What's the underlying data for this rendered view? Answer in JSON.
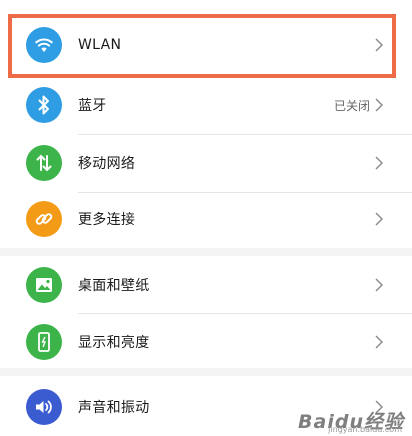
{
  "settings": {
    "items": [
      {
        "label": "WLAN",
        "value": "",
        "icon": "wifi-icon",
        "icon_color": "#2f9de4",
        "highlighted": true
      },
      {
        "label": "蓝牙",
        "value": "已关闭",
        "icon": "bluetooth-icon",
        "icon_color": "#2f9de4"
      },
      {
        "label": "移动网络",
        "value": "",
        "icon": "mobile-data-icon",
        "icon_color": "#3cb44a"
      },
      {
        "label": "更多连接",
        "value": "",
        "icon": "link-icon",
        "icon_color": "#f39a16"
      },
      {
        "label": "桌面和壁纸",
        "value": "",
        "icon": "wallpaper-icon",
        "icon_color": "#3cb44a"
      },
      {
        "label": "显示和亮度",
        "value": "",
        "icon": "display-icon",
        "icon_color": "#3cb44a"
      },
      {
        "label": "声音和振动",
        "value": "",
        "icon": "sound-icon",
        "icon_color": "#3b5bd1"
      }
    ]
  },
  "highlight_color": "#ee6b47",
  "watermark": {
    "text": "Baidu经验",
    "sub": "jingyan.baidu.com"
  }
}
